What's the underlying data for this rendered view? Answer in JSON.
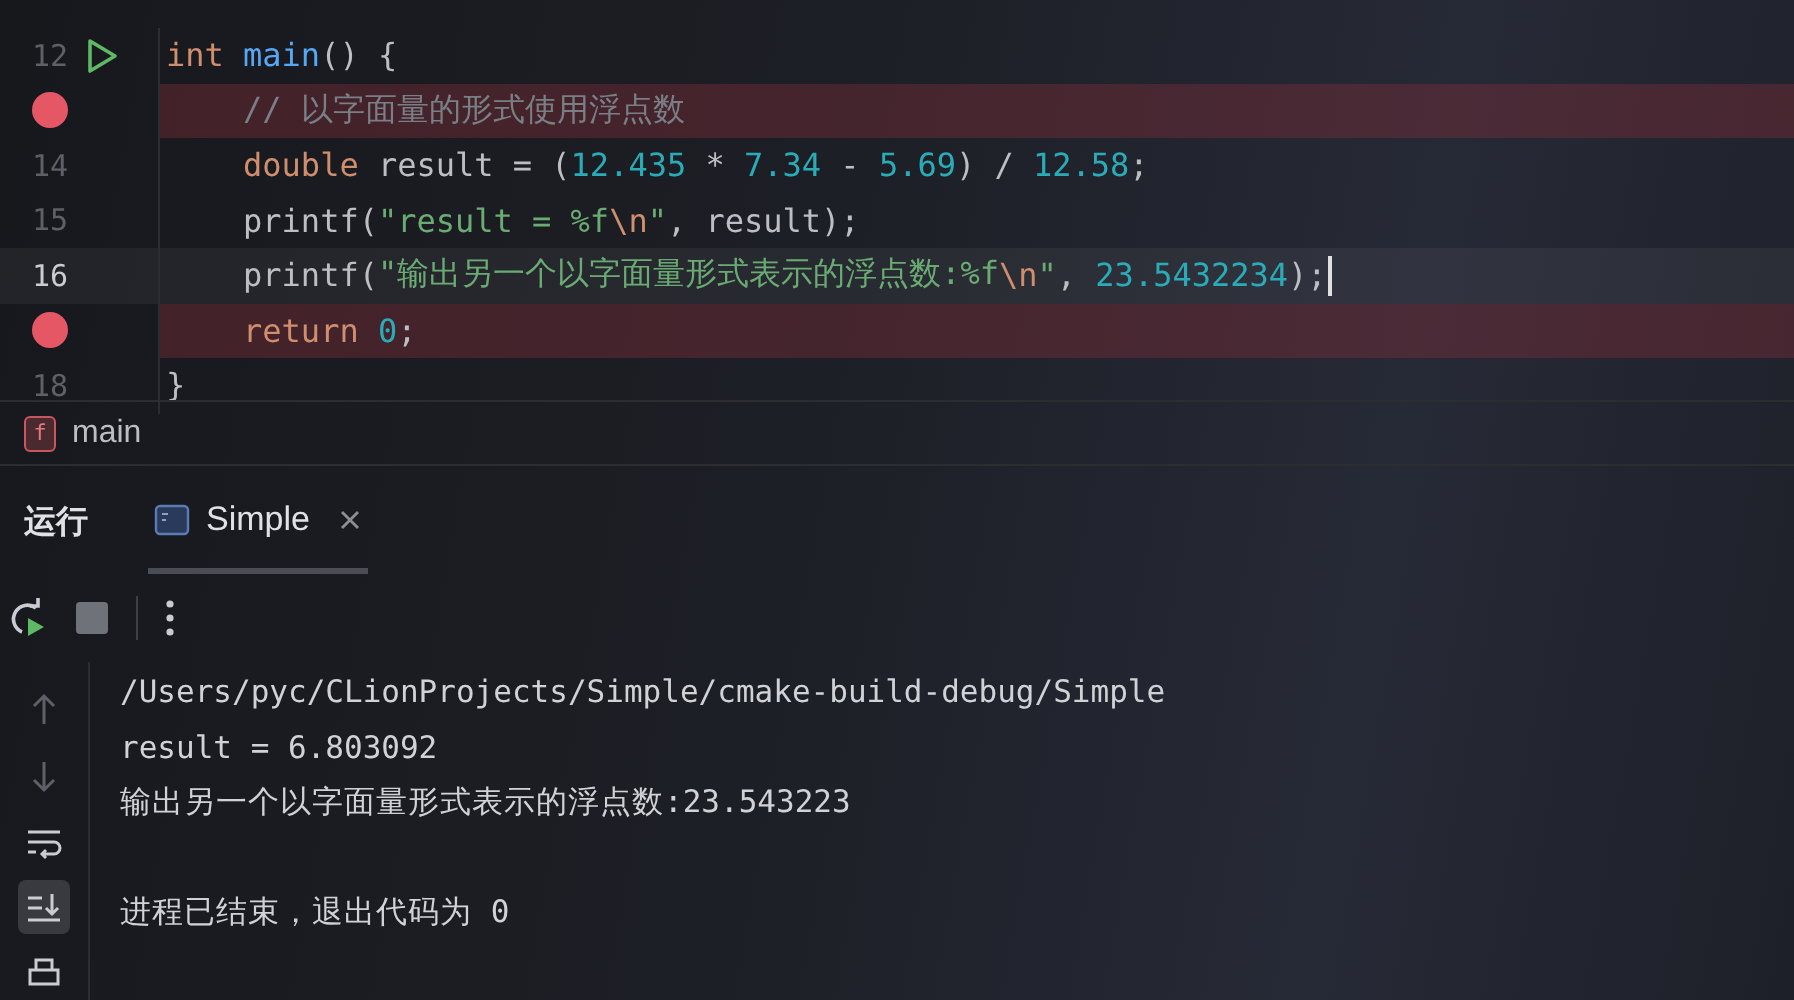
{
  "editor": {
    "lines": [
      {
        "number": "12",
        "breakpoint": false,
        "run_marker": true,
        "current": false,
        "tokens": [
          {
            "kind": "keyword",
            "text": "int "
          },
          {
            "kind": "function",
            "text": "main"
          },
          {
            "kind": "plain",
            "text": "() {"
          }
        ]
      },
      {
        "breakpoint": true,
        "run_marker": false,
        "current": false,
        "tokens": [
          {
            "kind": "comment",
            "text": "    // 以字面量的形式使用浮点数"
          }
        ]
      },
      {
        "number": "14",
        "breakpoint": false,
        "run_marker": false,
        "current": false,
        "tokens": [
          {
            "kind": "keyword",
            "text": "    double"
          },
          {
            "kind": "plain",
            "text": " result = ("
          },
          {
            "kind": "number",
            "text": "12.435"
          },
          {
            "kind": "plain",
            "text": " * "
          },
          {
            "kind": "number",
            "text": "7.34"
          },
          {
            "kind": "plain",
            "text": " - "
          },
          {
            "kind": "number",
            "text": "5.69"
          },
          {
            "kind": "plain",
            "text": ") / "
          },
          {
            "kind": "number",
            "text": "12.58"
          },
          {
            "kind": "plain",
            "text": ";"
          }
        ]
      },
      {
        "number": "15",
        "breakpoint": false,
        "run_marker": false,
        "current": false,
        "tokens": [
          {
            "kind": "plain",
            "text": "    printf("
          },
          {
            "kind": "string",
            "text": "\"result = %f"
          },
          {
            "kind": "escape",
            "text": "\\n"
          },
          {
            "kind": "string",
            "text": "\""
          },
          {
            "kind": "plain",
            "text": ", result);"
          }
        ]
      },
      {
        "number": "16",
        "breakpoint": false,
        "run_marker": false,
        "current": true,
        "tokens": [
          {
            "kind": "plain",
            "text": "    printf("
          },
          {
            "kind": "string",
            "text": "\"输出另一个以字面量形式表示的浮点数:%f"
          },
          {
            "kind": "escape",
            "text": "\\n"
          },
          {
            "kind": "string",
            "text": "\""
          },
          {
            "kind": "plain",
            "text": ", "
          },
          {
            "kind": "number",
            "text": "23.5432234"
          },
          {
            "kind": "plain",
            "text": ");"
          }
        ]
      },
      {
        "breakpoint": true,
        "run_marker": false,
        "current": false,
        "tokens": [
          {
            "kind": "keyword",
            "text": "    return "
          },
          {
            "kind": "number",
            "text": "0"
          },
          {
            "kind": "plain",
            "text": ";"
          }
        ]
      },
      {
        "number": "18",
        "breakpoint": false,
        "run_marker": false,
        "current": false,
        "tokens": [
          {
            "kind": "plain",
            "text": "}"
          }
        ]
      }
    ]
  },
  "breadcrumb": {
    "icon_letter": "f",
    "label": "main"
  },
  "run_panel": {
    "title": "运行",
    "tabs": [
      {
        "label": "Simple",
        "selected": true
      }
    ],
    "side_tools": [
      {
        "kind": "up",
        "selected": false
      },
      {
        "kind": "down",
        "selected": false
      },
      {
        "kind": "wrap",
        "selected": false
      },
      {
        "kind": "scroll-end",
        "selected": true
      },
      {
        "kind": "print",
        "selected": false
      }
    ],
    "console": [
      {
        "text": "/Users/pyc/CLionProjects/Simple/cmake-build-debug/Simple",
        "gap_before": false
      },
      {
        "text": "result = 6.803092",
        "gap_before": false
      },
      {
        "text": "输出另一个以字面量形式表示的浮点数:23.543223",
        "gap_before": false
      },
      {
        "text": "进程已结束，退出代码为 0",
        "gap_before": true
      }
    ]
  }
}
